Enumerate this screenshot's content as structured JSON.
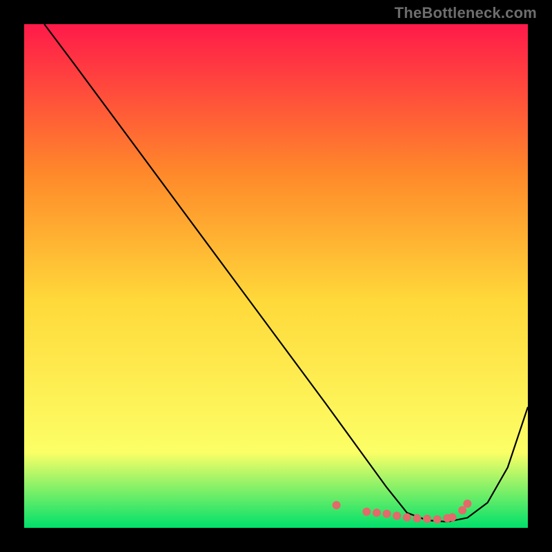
{
  "watermark": "TheBottleneck.com",
  "chart_data": {
    "type": "line",
    "title": "",
    "xlabel": "",
    "ylabel": "",
    "xlim": [
      0,
      100
    ],
    "ylim": [
      0,
      100
    ],
    "background_gradient": {
      "top": "#ff1a4a",
      "upper_mid": "#ff8a2a",
      "mid": "#ffd93a",
      "lower": "#fcff66",
      "bottom": "#00e06a"
    },
    "curve": {
      "name": "bottleneck-curve",
      "x": [
        4,
        10,
        20,
        30,
        40,
        50,
        60,
        64,
        68,
        72,
        76,
        80,
        84,
        88,
        92,
        96,
        100
      ],
      "y": [
        100,
        92,
        78.5,
        65,
        51.5,
        38,
        24.5,
        19,
        13.5,
        8,
        3,
        1.5,
        1.2,
        2,
        5,
        12,
        24
      ]
    },
    "markers": {
      "x": [
        62,
        68,
        70,
        72,
        74,
        76,
        78,
        80,
        82,
        84,
        85,
        87,
        88
      ],
      "y": [
        4.5,
        3.2,
        3.0,
        2.8,
        2.4,
        2.1,
        1.9,
        1.8,
        1.7,
        1.9,
        2.1,
        3.5,
        4.8
      ],
      "color": "#e36a6a",
      "radius": 6
    }
  }
}
